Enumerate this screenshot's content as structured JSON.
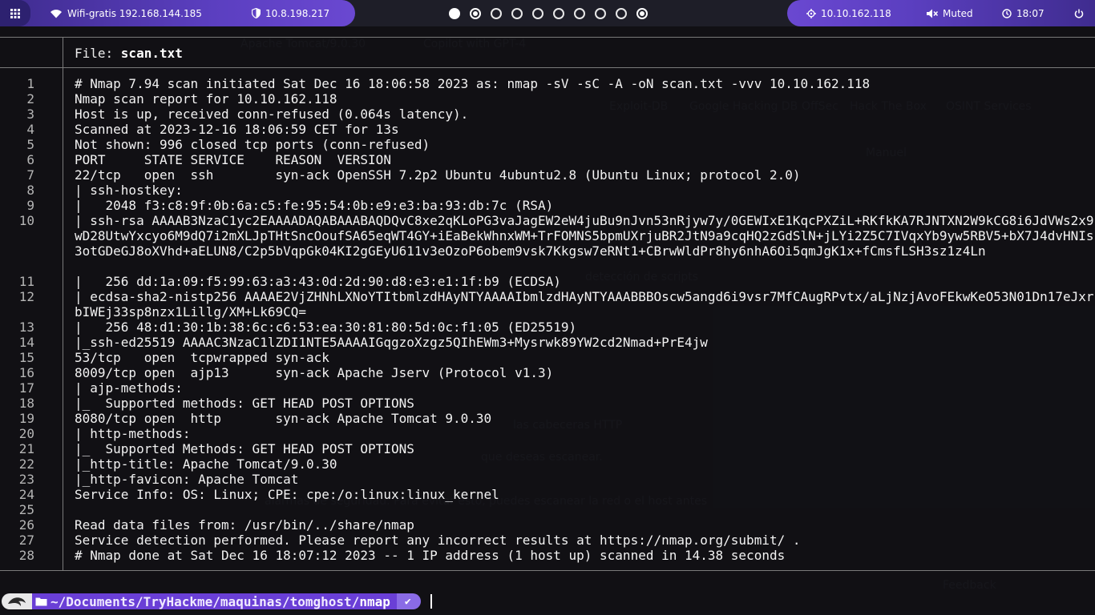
{
  "topbar": {
    "wifi": "Wifi-gratis 192.168.144.185",
    "vpn": "10.8.198.217",
    "target": "10.10.162.118",
    "audio": "Muted",
    "clock": "18:07",
    "workspaces": [
      "filled",
      "active",
      "empty",
      "empty",
      "empty",
      "empty",
      "empty",
      "empty",
      "empty",
      "active"
    ]
  },
  "viewer": {
    "label": "File: ",
    "filename": "scan.txt"
  },
  "lines": [
    {
      "n": "1",
      "t": "# Nmap 7.94 scan initiated Sat Dec 16 18:06:58 2023 as: nmap -sV -sC -A -oN scan.txt -vvv 10.10.162.118"
    },
    {
      "n": "2",
      "t": "Nmap scan report for 10.10.162.118"
    },
    {
      "n": "3",
      "t": "Host is up, received conn-refused (0.064s latency)."
    },
    {
      "n": "4",
      "t": "Scanned at 2023-12-16 18:06:59 CET for 13s"
    },
    {
      "n": "5",
      "t": "Not shown: 996 closed tcp ports (conn-refused)"
    },
    {
      "n": "6",
      "t": "PORT     STATE SERVICE    REASON  VERSION"
    },
    {
      "n": "7",
      "t": "22/tcp   open  ssh        syn-ack OpenSSH 7.2p2 Ubuntu 4ubuntu2.8 (Ubuntu Linux; protocol 2.0)"
    },
    {
      "n": "8",
      "t": "| ssh-hostkey:"
    },
    {
      "n": "9",
      "t": "|   2048 f3:c8:9f:0b:6a:c5:fe:95:54:0b:e9:e3:ba:93:db:7c (RSA)"
    },
    {
      "n": "10",
      "t": "| ssh-rsa AAAAB3NzaC1yc2EAAAADAQABAAABAQDQvC8xe2qKLoPG3vaJagEW2eW4juBu9nJvn53nRjyw7y/0GEWIxE1KqcPXZiL+RKfkKA7RJNTXN2W9kCG8i6JdVWs2x9wD28UtwYxcyo6M9dQ7i2mXLJpTHtSncOoufSA65eqWT4GY+iEaBekWhnxWM+TrFOMNS5bpmUXrjuBR2JtN9a9cqHQ2zGdSlN+jLYi2Z5C7IVqxYb9yw5RBV5+bX7J4dvHNIs3otGDeGJ8oXVhd+aELUN8/C2p5bVqpGk04KI2gGEyU611v3eOzoP6obem9vsk7Kkgsw7eRNt1+CBrwWldPr8hy6nhA6Oi5qmJgK1x+fCmsfLSH3sz1z4Ln"
    },
    {
      "n": "11",
      "t": "|   256 dd:1a:09:f5:99:63:a3:43:0d:2d:90:d8:e3:e1:1f:b9 (ECDSA)"
    },
    {
      "n": "12",
      "t": "| ecdsa-sha2-nistp256 AAAAE2VjZHNhLXNoYTItbmlzdHAyNTYAAAAIbmlzdHAyNTYAAABBBOscw5angd6i9vsr7MfCAugRPvtx/aLjNzjAvoFEkwKeO53N01Dn17eJxrbIWEj33sp8nzx1Lillg/XM+Lk69CQ="
    },
    {
      "n": "13",
      "t": "|   256 48:d1:30:1b:38:6c:c6:53:ea:30:81:80:5d:0c:f1:05 (ED25519)"
    },
    {
      "n": "14",
      "t": "|_ssh-ed25519 AAAAC3NzaC1lZDI1NTE5AAAAIGqgzoXzgz5QIhEWm3+Mysrwk89YW2cd2Nmad+PrE4jw"
    },
    {
      "n": "15",
      "t": "53/tcp   open  tcpwrapped syn-ack"
    },
    {
      "n": "16",
      "t": "8009/tcp open  ajp13      syn-ack Apache Jserv (Protocol v1.3)"
    },
    {
      "n": "17",
      "t": "| ajp-methods:"
    },
    {
      "n": "18",
      "t": "|_  Supported methods: GET HEAD POST OPTIONS"
    },
    {
      "n": "19",
      "t": "8080/tcp open  http       syn-ack Apache Tomcat 9.0.30"
    },
    {
      "n": "20",
      "t": "| http-methods:"
    },
    {
      "n": "21",
      "t": "|_  Supported Methods: GET HEAD POST OPTIONS"
    },
    {
      "n": "22",
      "t": "|_http-title: Apache Tomcat/9.0.30"
    },
    {
      "n": "23",
      "t": "|_http-favicon: Apache Tomcat"
    },
    {
      "n": "24",
      "t": "Service Info: OS: Linux; CPE: cpe:/o:linux:linux_kernel"
    },
    {
      "n": "25",
      "t": ""
    },
    {
      "n": "26",
      "t": "Read data files from: /usr/bin/../share/nmap"
    },
    {
      "n": "27",
      "t": "Service detection performed. Please report any incorrect results at https://nmap.org/submit/ ."
    },
    {
      "n": "28",
      "t": "# Nmap done at Sat Dec 16 18:07:12 2023 -- 1 IP address (1 host up) scanned in 14.38 seconds"
    }
  ],
  "prompt": {
    "path": "~/Documents/TryHackme/maquinas/tomghost/",
    "leaf": "nmap",
    "status": "✔"
  },
  "colors": {
    "accent": "#5b3fc0",
    "prompt_dir": "#6a3fd6",
    "prompt_status": "#8a6be6"
  },
  "icons": [
    "menu-icon",
    "wifi-icon",
    "shield-icon",
    "target-icon",
    "muted-speaker-icon",
    "clock-icon",
    "power-icon",
    "kali-dragon-icon",
    "folder-icon"
  ]
}
